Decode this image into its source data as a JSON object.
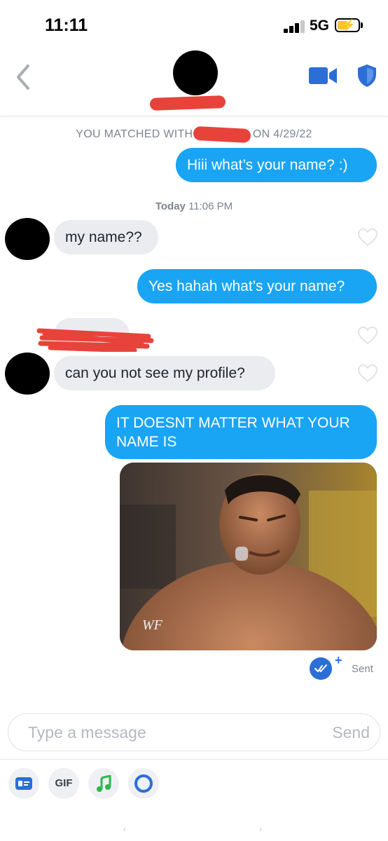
{
  "status_bar": {
    "time": "11:11",
    "network": "5G"
  },
  "header": {
    "back_icon": "chevron-left-icon",
    "video_icon": "video-camera-icon",
    "safety_icon": "shield-icon",
    "accent_color": "#2b6fd6"
  },
  "match_info": {
    "text": "YOU MATCHED WITH",
    "date_text": "ON 4/29/22"
  },
  "timestamp": {
    "day": "Today",
    "time": "11:06 PM"
  },
  "messages": [
    {
      "direction": "out",
      "text": "Hiii what’s your name? :)"
    },
    {
      "direction": "in",
      "text": "my name??"
    },
    {
      "direction": "out",
      "text": "Yes hahah what’s your name?"
    },
    {
      "direction": "in",
      "text": "can you not see my profile?"
    },
    {
      "direction": "out",
      "text": "IT DOESNT MATTER WHAT YOUR NAME IS"
    }
  ],
  "gif": {
    "watermark": "WF"
  },
  "delivery": {
    "status": "Sent",
    "plus": "+"
  },
  "composer": {
    "placeholder": "Type a message",
    "send_label": "Send"
  },
  "toolbar": {
    "gif_label": "GIF",
    "items": [
      "sticker-card-icon",
      "gif-button",
      "music-note-icon",
      "vibe-ring-icon"
    ]
  },
  "colors": {
    "outgoing_bubble": "#1aa4f4",
    "incoming_bubble": "#eaecf0",
    "redaction": "#e8433b"
  }
}
